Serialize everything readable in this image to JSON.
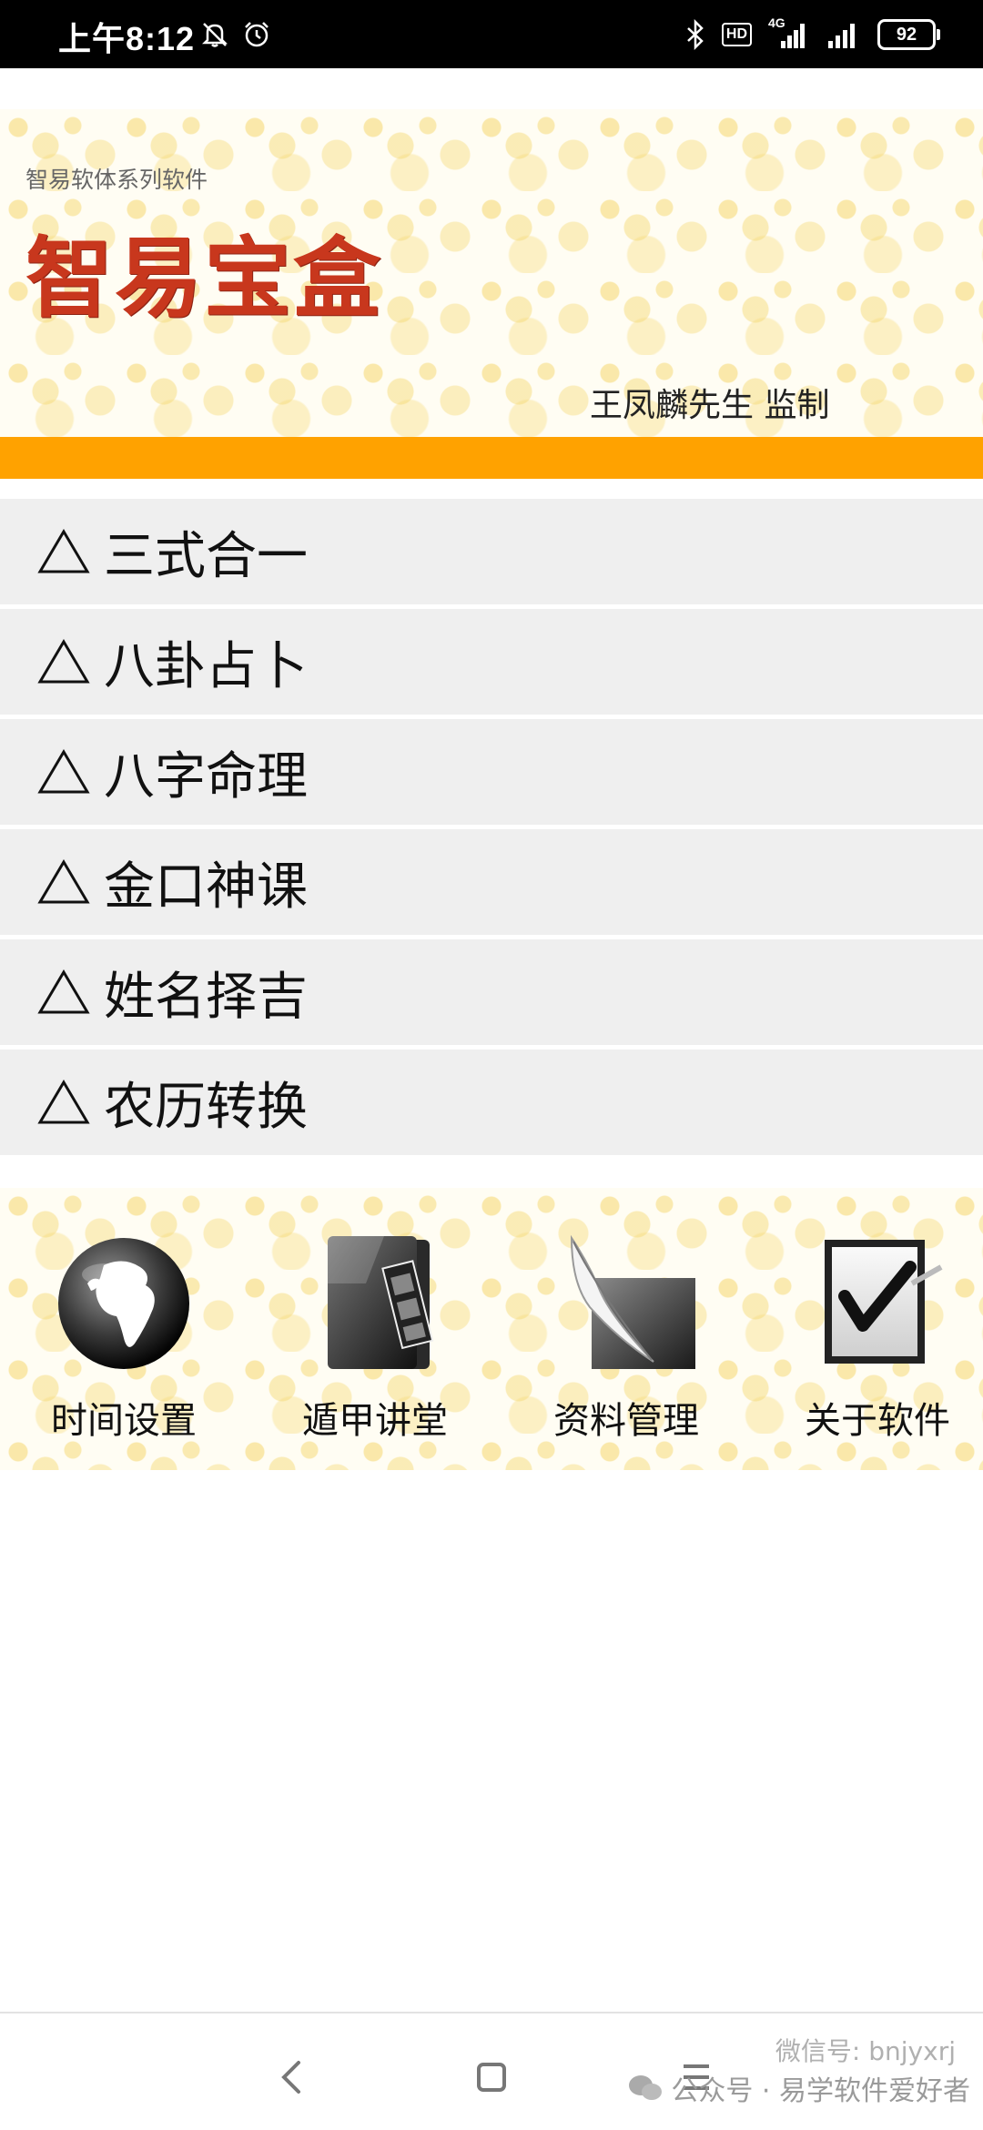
{
  "status_bar": {
    "time": "上午8:12",
    "hd": "HD",
    "network": "4G",
    "battery": "92",
    "icons": [
      "mute-icon",
      "alarm-icon",
      "bluetooth-icon",
      "signal-icon",
      "signal-icon",
      "battery-icon"
    ]
  },
  "banner": {
    "series": "智易软体系列软件",
    "title": "智易宝盒",
    "supervisor": "王凤麟先生 监制"
  },
  "colors": {
    "title_red": "#c8371d",
    "orange_bar": "#ffa200",
    "menu_bg": "#efefef"
  },
  "menu": {
    "items": [
      {
        "label": "三式合一",
        "icon": "triangle-icon"
      },
      {
        "label": "八卦占卜",
        "icon": "triangle-icon"
      },
      {
        "label": "八字命理",
        "icon": "triangle-icon"
      },
      {
        "label": "金口神课",
        "icon": "triangle-icon"
      },
      {
        "label": "姓名择吉",
        "icon": "triangle-icon"
      },
      {
        "label": "农历转换",
        "icon": "triangle-icon"
      }
    ]
  },
  "toolbar": {
    "items": [
      {
        "label": "时间设置",
        "icon": "globe-icon"
      },
      {
        "label": "遁甲讲堂",
        "icon": "folder-film-icon"
      },
      {
        "label": "资料管理",
        "icon": "feather-icon"
      },
      {
        "label": "关于软件",
        "icon": "checkbox-icon"
      }
    ]
  },
  "watermark": {
    "text": "公众号 · 易学软件爱好者",
    "overlay": "微信号: bnjyxrj"
  }
}
